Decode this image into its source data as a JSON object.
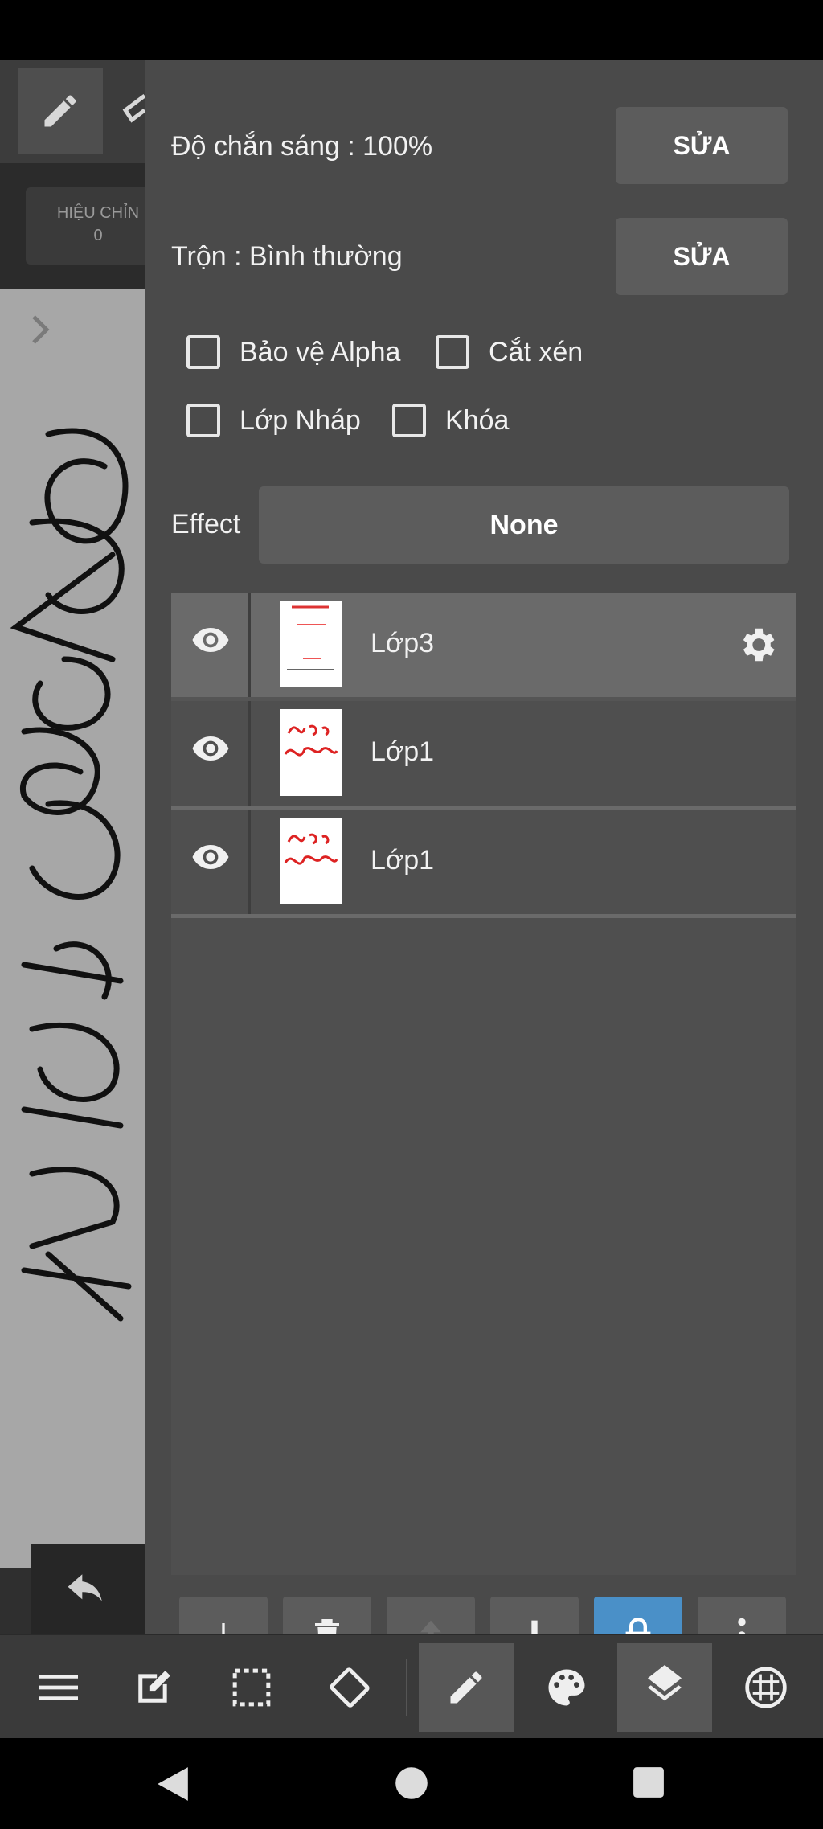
{
  "left": {
    "adjust_label": "HIỆU CHỈN",
    "adjust_value": "0"
  },
  "panel": {
    "opacity_label": "Độ chắn sáng : 100%",
    "opacity_edit": "SỬA",
    "blend_label": "Trộn : Bình thường",
    "blend_edit": "SỬA",
    "checkboxes": [
      {
        "label": "Bảo vệ Alpha",
        "checked": false
      },
      {
        "label": "Cắt xén",
        "checked": false
      },
      {
        "label": "Lớp Nháp",
        "checked": false
      },
      {
        "label": "Khóa",
        "checked": false
      }
    ],
    "effect_label": "Effect",
    "effect_value": "None"
  },
  "layers": [
    {
      "name": "Lớp3",
      "visible": true,
      "selected": true
    },
    {
      "name": "Lớp1",
      "visible": true,
      "selected": false
    },
    {
      "name": "Lớp1",
      "visible": true,
      "selected": false
    }
  ],
  "layer_actions": [
    "add-icon",
    "delete-icon",
    "move-up-icon",
    "move-down-icon",
    "lock-icon",
    "more-icon"
  ],
  "bottom_toolbar": [
    "menu-icon",
    "edit-icon",
    "selection-icon",
    "rotate-icon",
    "pen-icon",
    "palette-icon",
    "layers-icon",
    "grid-icon"
  ],
  "colors": {
    "panel_bg": "#4a4a4a",
    "button_bg": "#5c5c5c",
    "selected_layer": "#6a6a6a",
    "lock_active": "#4a90c8"
  }
}
